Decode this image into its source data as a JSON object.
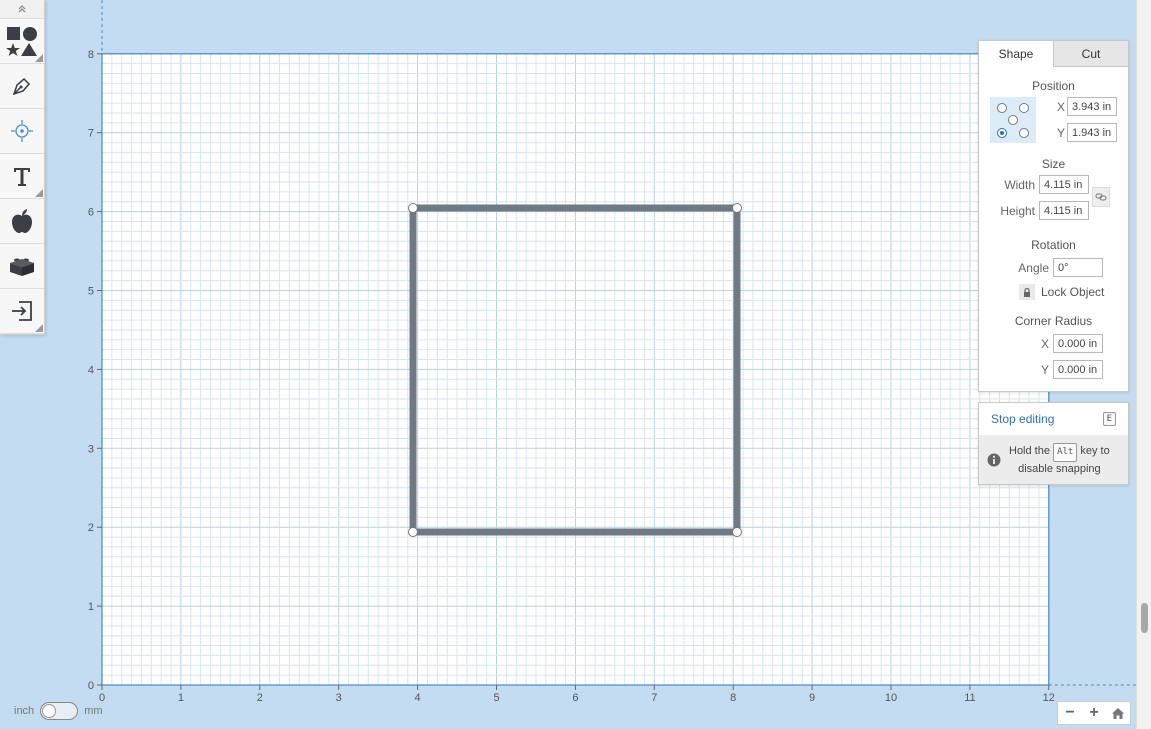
{
  "canvas": {
    "x_ticks": [
      "0",
      "1",
      "2",
      "3",
      "4",
      "5",
      "6",
      "7",
      "8",
      "9",
      "10",
      "11",
      "12"
    ],
    "y_ticks": [
      "0",
      "1",
      "2",
      "3",
      "4",
      "5",
      "6",
      "7",
      "8"
    ],
    "colors": {
      "grid_minor": "#d6e6f0",
      "grid_major": "#b9d3e4",
      "board_border": "#4a87c4",
      "shape_stroke": "#6f7a84"
    }
  },
  "toolbar": {
    "icons": [
      "collapse-icon",
      "shapes-icon",
      "pen-icon",
      "target-icon",
      "text-icon",
      "apple-icon",
      "brick-icon",
      "import-icon"
    ]
  },
  "panel": {
    "tabs": {
      "shape": "Shape",
      "cut": "Cut"
    },
    "position": {
      "title": "Position",
      "x_label": "X",
      "x_value": "3.943 in",
      "y_label": "Y",
      "y_value": "1.943 in"
    },
    "size": {
      "title": "Size",
      "width_label": "Width",
      "width_value": "4.115 in",
      "height_label": "Height",
      "height_value": "4.115 in"
    },
    "rotation": {
      "title": "Rotation",
      "angle_label": "Angle",
      "angle_value": "0°",
      "lock_label": "Lock Object"
    },
    "corner_radius": {
      "title": "Corner Radius",
      "x_label": "X",
      "x_value": "0.000 in",
      "y_label": "Y",
      "y_value": "0.000 in"
    }
  },
  "editing": {
    "stop_label": "Stop editing",
    "stop_key": "E",
    "hint_before": "Hold the",
    "hint_key": "Alt",
    "hint_after1": "key to",
    "hint_after2": "disable snapping"
  },
  "units": {
    "left": "inch",
    "right": "mm"
  },
  "zoom": {
    "minus": "−",
    "plus": "+"
  }
}
